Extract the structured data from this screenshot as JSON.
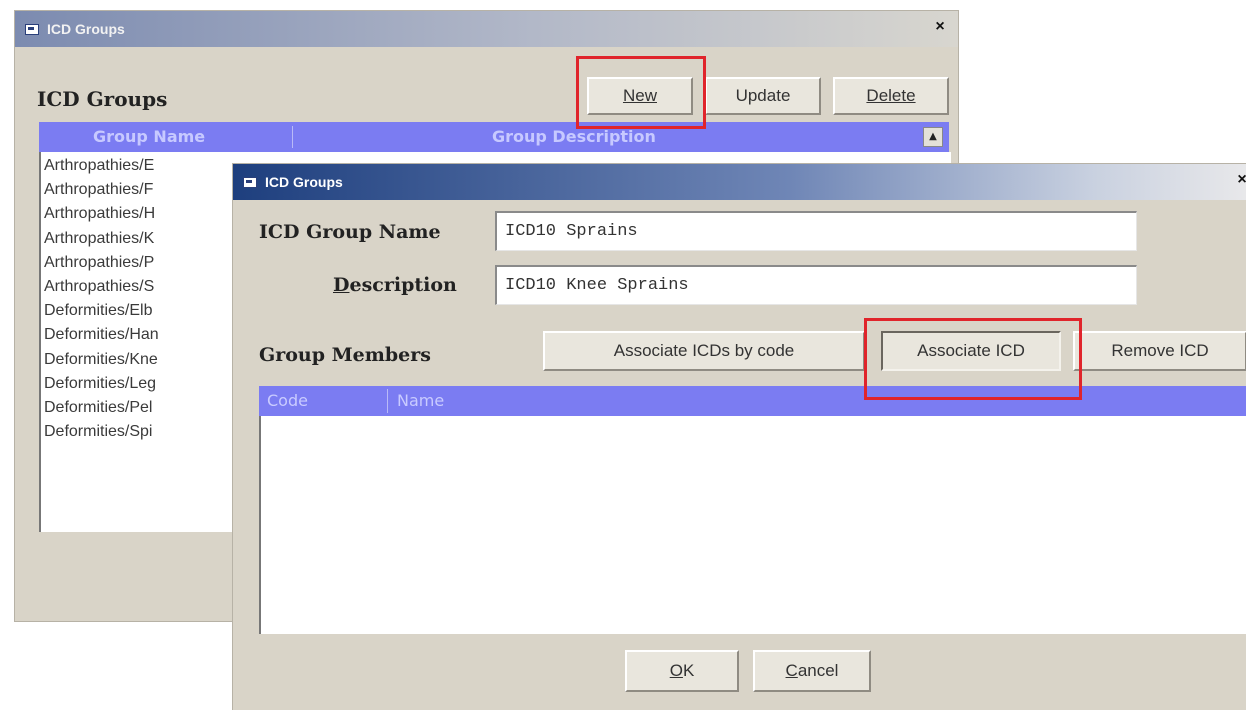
{
  "back_window": {
    "title": "ICD Groups",
    "close_glyph": "×",
    "section_title": "ICD Groups",
    "buttons": {
      "new": "New",
      "update": "Update",
      "delete": "Delete"
    },
    "columns": {
      "group_name": "Group Name",
      "group_description": "Group Description"
    },
    "scroll_up_glyph": "▲",
    "list_items": [
      "Arthropathies/E",
      "Arthropathies/F",
      "Arthropathies/H",
      "Arthropathies/K",
      "Arthropathies/P",
      "Arthropathies/S",
      "Deformities/Elb",
      "Deformities/Han",
      "Deformities/Kne",
      "Deformities/Leg",
      "Deformities/Pel",
      "Deformities/Spi"
    ]
  },
  "front_dialog": {
    "title": "ICD Groups",
    "close_glyph": "×",
    "group_name_label": "ICD Group Name",
    "group_name_value": "ICD10 Sprains",
    "description_label_prefix": "",
    "description_label_accel": "D",
    "description_label_rest": "escription",
    "description_value": "ICD10 Knee Sprains",
    "members_label": "Group Members",
    "buttons": {
      "associate_by_code": "Associate ICDs by code",
      "associate": "Associate ICD",
      "remove": "Remove ICD",
      "ok_accel": "O",
      "ok_rest": "K",
      "cancel_accel": "C",
      "cancel_rest": "ancel"
    },
    "columns": {
      "code": "Code",
      "name": "Name"
    }
  },
  "colors": {
    "highlight": "#e0242b",
    "header_blue": "#7b7cf2",
    "title_active": "#2a4a8a",
    "title_inactive": "#8e99b5"
  }
}
